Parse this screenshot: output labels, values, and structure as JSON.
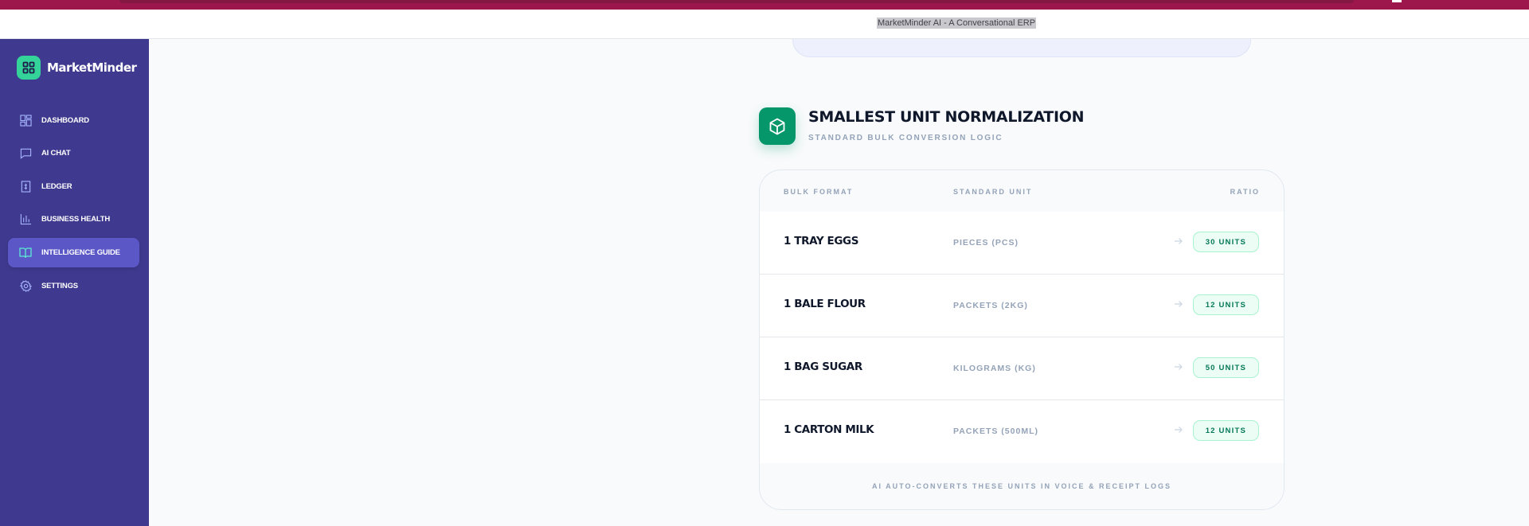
{
  "window": {
    "title": "MarketMinder AI - A Conversational ERP"
  },
  "brand": {
    "name": "MarketMinder",
    "icon": "grid-icon",
    "accent": "#34d399"
  },
  "sidebar": {
    "bg": "#3f3a8f",
    "items": [
      {
        "label": "DASHBOARD",
        "icon": "layout-grid-icon",
        "active": false
      },
      {
        "label": "AI CHAT",
        "icon": "message-square-icon",
        "active": false
      },
      {
        "label": "LEDGER",
        "icon": "receipt-icon",
        "active": false
      },
      {
        "label": "BUSINESS HEALTH",
        "icon": "bar-chart-icon",
        "active": false
      },
      {
        "label": "INTELLIGENCE GUIDE",
        "icon": "book-open-icon",
        "active": true
      },
      {
        "label": "SETTINGS",
        "icon": "gear-icon",
        "active": false
      }
    ]
  },
  "section": {
    "icon": "package-icon",
    "title": "SMALLEST UNIT NORMALIZATION",
    "subtitle": "STANDARD BULK CONVERSION LOGIC",
    "accent": "#059669"
  },
  "table": {
    "headers": [
      "BULK FORMAT",
      "STANDARD UNIT",
      "RATIO"
    ],
    "rows": [
      {
        "bulk": "1 TRAY EGGS",
        "unit": "PIECES (PCS)",
        "ratio": "30 UNITS"
      },
      {
        "bulk": "1 BALE FLOUR",
        "unit": "PACKETS (2KG)",
        "ratio": "12 UNITS"
      },
      {
        "bulk": "1 BAG SUGAR",
        "unit": "KILOGRAMS (KG)",
        "ratio": "50 UNITS"
      },
      {
        "bulk": "1 CARTON MILK",
        "unit": "PACKETS (500ML)",
        "ratio": "12 UNITS"
      }
    ],
    "footer": "AI AUTO-CONVERTS THESE UNITS IN VOICE & RECEIPT LOGS"
  }
}
